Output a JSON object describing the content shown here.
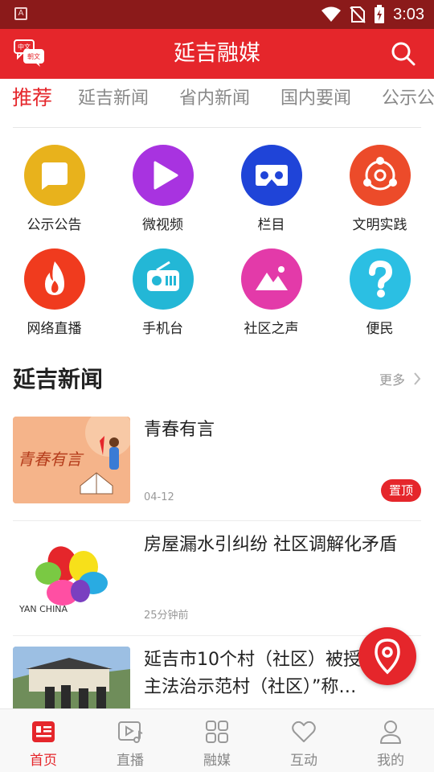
{
  "status_bar": {
    "time": "3:03"
  },
  "header": {
    "title": "延吉融媒",
    "lang_badge_top": "中文",
    "lang_badge_bottom": "朝文"
  },
  "tabs": [
    {
      "label": "推荐",
      "active": true
    },
    {
      "label": "延吉新闻",
      "active": false
    },
    {
      "label": "省内新闻",
      "active": false
    },
    {
      "label": "国内要闻",
      "active": false
    },
    {
      "label": "公示公",
      "active": false
    }
  ],
  "grid": [
    {
      "label": "公示公告",
      "color": "#e8b21c",
      "icon": "chat-bubble-icon"
    },
    {
      "label": "微视频",
      "color": "#a833e0",
      "icon": "play-icon"
    },
    {
      "label": "栏目",
      "color": "#1f44d8",
      "icon": "vr-goggles-icon"
    },
    {
      "label": "文明实践",
      "color": "#ec4b2a",
      "icon": "share-network-icon"
    },
    {
      "label": "网络直播",
      "color": "#f03b1e",
      "icon": "flame-icon"
    },
    {
      "label": "手机台",
      "color": "#23b7d6",
      "icon": "radio-icon"
    },
    {
      "label": "社区之声",
      "color": "#e33aa9",
      "icon": "landscape-icon"
    },
    {
      "label": "便民",
      "color": "#2bbfe3",
      "icon": "help-icon"
    }
  ],
  "section": {
    "title": "延吉新闻",
    "more_label": "更多"
  },
  "news": [
    {
      "title": "青春有言",
      "time": "04-12",
      "pinned": true,
      "badge": "置顶",
      "thumb_text": "青春有言"
    },
    {
      "title": "房屋漏水引纠纷 社区调解化矛盾",
      "time": "25分钟前",
      "pinned": false,
      "thumb_text": "YAN  CHINA"
    },
    {
      "title": "延吉市10个村（社区）被授予“民主法治示范村（社区）”称…",
      "time": "",
      "pinned": false
    }
  ],
  "bottom_nav": [
    {
      "label": "首页",
      "icon": "home-news-icon",
      "active": true
    },
    {
      "label": "直播",
      "icon": "live-video-icon",
      "active": false
    },
    {
      "label": "融媒",
      "icon": "grid-apps-icon",
      "active": false
    },
    {
      "label": "互动",
      "icon": "heart-icon",
      "active": false
    },
    {
      "label": "我的",
      "icon": "user-icon",
      "active": false
    }
  ],
  "colors": {
    "brand": "#e5262b",
    "status_bar": "#8b1a1a"
  }
}
